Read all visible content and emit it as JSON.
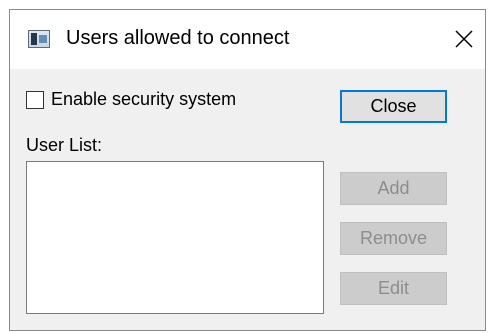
{
  "window": {
    "title": "Users allowed to connect",
    "app_icon": "app-window-icon",
    "close_glyph": "close-icon"
  },
  "security": {
    "checkbox_label": "Enable security system",
    "checked": false
  },
  "user_list": {
    "label": "User List:",
    "items": []
  },
  "buttons": {
    "close": "Close",
    "add": "Add",
    "remove": "Remove",
    "edit": "Edit"
  },
  "colors": {
    "focus_border": "#0078d7",
    "dialog_bg": "#f0f0f0",
    "disabled_bg": "#cccccc",
    "disabled_text": "#8d8d8d"
  }
}
